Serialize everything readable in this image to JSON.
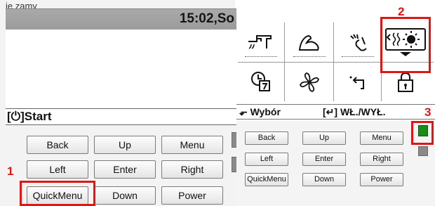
{
  "colors": {
    "highlight": "#e01515",
    "led_on": "#1a8c1a",
    "led_off": "#8a8a8a"
  },
  "left_panel": {
    "top_fragment": "ię zamy",
    "status_time": "15:02,So",
    "start_label": "[⏻]Start",
    "buttons": {
      "back": "Back",
      "up": "Up",
      "menu": "Menu",
      "left": "Left",
      "enter": "Enter",
      "right": "Right",
      "quickmenu": "QuickMenu",
      "down": "Down",
      "power": "Power"
    }
  },
  "right_panel": {
    "icons": [
      "faucet-hot-water-icon",
      "muscle-boost-icon",
      "hand-touch-icon",
      "heating-sun-icon",
      "timer-program-icon",
      "fan-flower-icon",
      "return-arrow-icon",
      "lock-icon"
    ],
    "footer_left": "Wybór",
    "footer_right": "[↵] WŁ./WYŁ.",
    "buttons": {
      "back": "Back",
      "up": "Up",
      "menu": "Menu",
      "left": "Left",
      "enter": "Enter",
      "right": "Right",
      "quickmenu": "QuickMenu",
      "down": "Down",
      "power": "Power"
    }
  },
  "annotations": {
    "one": "1",
    "two": "2",
    "three": "3"
  }
}
